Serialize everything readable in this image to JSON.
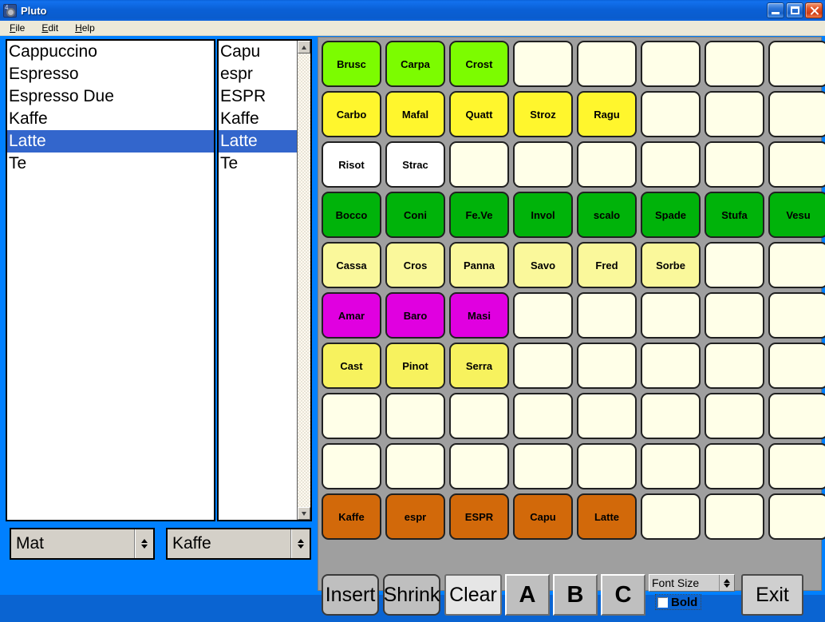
{
  "window": {
    "title": "Pluto",
    "icon": "app-icon",
    "controls": [
      {
        "name": "minimize-button",
        "glyph": "_"
      },
      {
        "name": "maximize-button",
        "glyph": "□"
      },
      {
        "name": "close-button",
        "glyph": "✕"
      }
    ]
  },
  "menubar": {
    "items": [
      {
        "label": "File",
        "accel": "F"
      },
      {
        "label": "Edit",
        "accel": "E"
      },
      {
        "label": "Help",
        "accel": "H"
      }
    ]
  },
  "left_panel": {
    "list_primary": {
      "items": [
        "Cappuccino",
        "Espresso",
        "Espresso Due",
        "Kaffe",
        "Latte",
        "Te"
      ],
      "selected": "Latte"
    },
    "list_secondary": {
      "items": [
        "Capu",
        "espr",
        "ESPR",
        "Kaffe",
        "Latte",
        "Te"
      ],
      "selected": "Latte",
      "scrollbar": {
        "up": "scroll-up-arrow",
        "down": "scroll-down-arrow"
      }
    },
    "combo_category": {
      "value": "Mat"
    },
    "combo_subcategory": {
      "value": "Kaffe"
    }
  },
  "colors": {
    "empty": "#FFFFE8",
    "chartreuse": "#7CFC00",
    "yellow": "#FFF62D",
    "white": "#FFFFFF",
    "green": "#00B30A",
    "pale_yellow": "#FAF89B",
    "magenta": "#E000E0",
    "light_yellow": "#F7F25E",
    "orange": "#D2690A",
    "panel": "#9F9F9F",
    "selection": "#3366CC",
    "titlebar": "#0A60D6",
    "client": "#0080FF"
  },
  "grid": {
    "columns": 8,
    "rows": [
      {
        "color": "chartreuse",
        "cells": [
          "Brusc",
          "Carpa",
          "Crost",
          "",
          "",
          "",
          "",
          ""
        ]
      },
      {
        "color": "yellow",
        "cells": [
          "Carbo",
          "Mafal",
          "Quatt",
          "Stroz",
          "Ragu",
          "",
          "",
          ""
        ]
      },
      {
        "color": "white",
        "cells": [
          "Risot",
          "Strac",
          "",
          "",
          "",
          "",
          "",
          ""
        ]
      },
      {
        "color": "green",
        "cells": [
          "Bocco",
          "Coni",
          "Fe.Ve",
          "Invol",
          "scalo",
          "Spade",
          "Stufa",
          "Vesu"
        ]
      },
      {
        "color": "pale_yellow",
        "cells": [
          "Cassa",
          "Cros",
          "Panna",
          "Savo",
          "Fred",
          "Sorbe",
          "",
          ""
        ]
      },
      {
        "color": "magenta",
        "cells": [
          "Amar",
          "Baro",
          "Masi",
          "",
          "",
          "",
          "",
          ""
        ]
      },
      {
        "color": "light_yellow",
        "cells": [
          "Cast",
          "Pinot",
          "Serra",
          "",
          "",
          "",
          "",
          ""
        ]
      },
      {
        "color": "empty",
        "cells": [
          "",
          "",
          "",
          "",
          "",
          "",
          "",
          ""
        ]
      },
      {
        "color": "empty",
        "cells": [
          "",
          "",
          "",
          "",
          "",
          "",
          "",
          ""
        ]
      },
      {
        "color": "orange",
        "cells": [
          "Kaffe",
          "espr",
          "ESPR",
          "Capu",
          "Latte",
          "",
          "",
          ""
        ]
      }
    ]
  },
  "toolbar": {
    "insert_label": "Insert",
    "shrink_label": "Shrink",
    "clear_label": "Clear",
    "letter_a": "A",
    "letter_b": "B",
    "letter_c": "C",
    "font_size_label": "Font Size",
    "bold_label": "Bold",
    "bold_checked": false,
    "exit_label": "Exit"
  }
}
